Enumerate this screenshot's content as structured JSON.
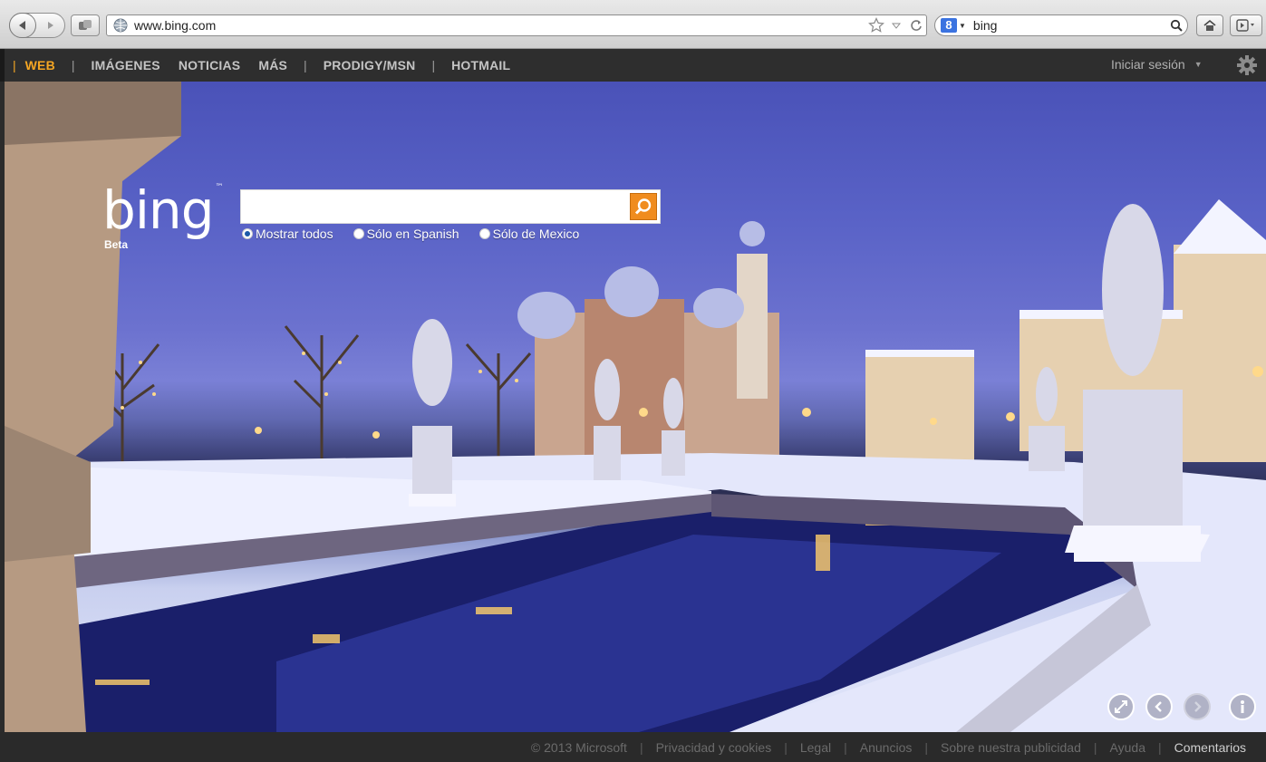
{
  "browser": {
    "url": "www.bing.com",
    "search_query": "bing",
    "search_engine_icon": "google-g-icon"
  },
  "nav": {
    "items": [
      "WEB",
      "IMÁGENES",
      "NOTICIAS",
      "MÁS",
      "PRODIGY/MSN",
      "HOTMAIL"
    ],
    "separator": "|",
    "signin": "Iniciar sesión"
  },
  "search": {
    "logo": "bing",
    "logo_tm": "™",
    "beta": "Beta",
    "value": "",
    "options": [
      "Mostrar todos",
      "Sólo en Spanish",
      "Sólo de Mexico"
    ],
    "selected_option": "Mostrar todos"
  },
  "footer": {
    "links": [
      "© 2013 Microsoft",
      "Privacidad y cookies",
      "Legal",
      "Anuncios",
      "Sobre nuestra publicidad",
      "Ayuda",
      "Comentarios"
    ],
    "separator": "|"
  },
  "colors": {
    "accent": "#f5a623",
    "search_button": "#f08c1e",
    "nav_bg": "#2e2e2e",
    "sky": "#5a63c7"
  }
}
